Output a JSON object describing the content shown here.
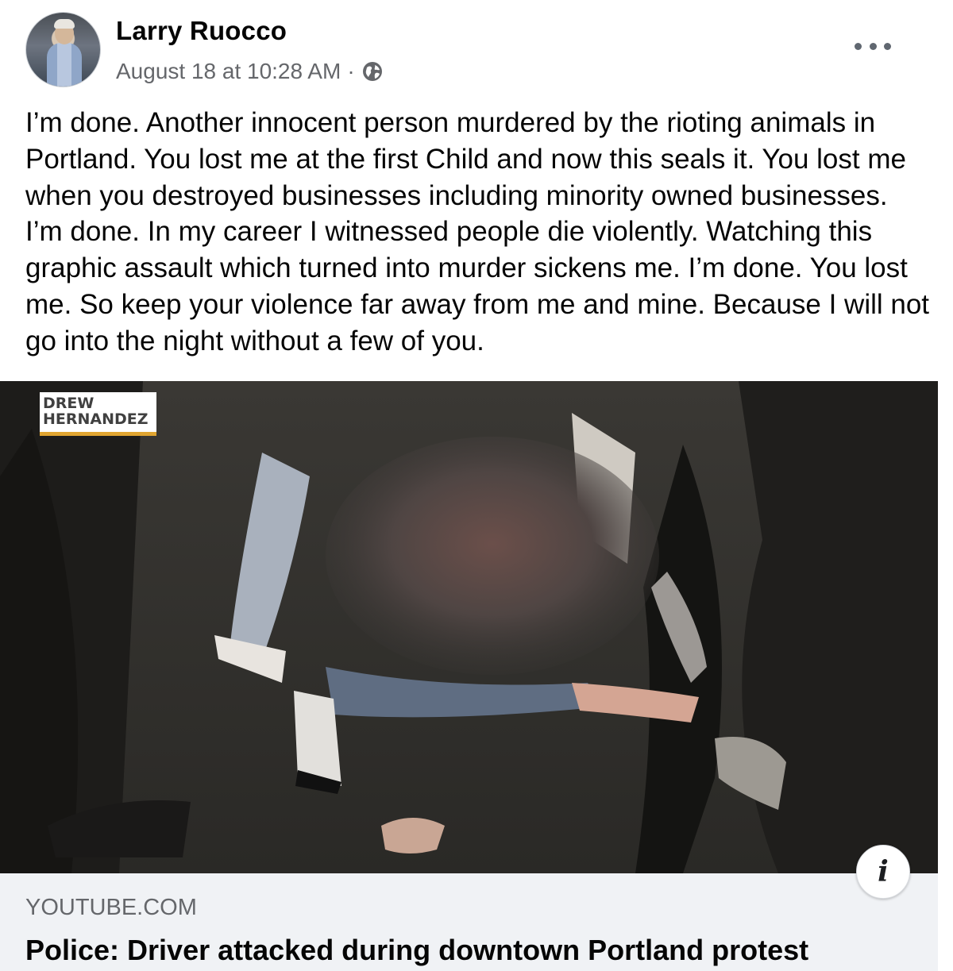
{
  "post": {
    "author": "Larry Ruocco",
    "timestamp": "August 18 at 10:28 AM",
    "separator": "·",
    "privacy_icon": "globe-icon",
    "more_icon": "more-options-icon",
    "text": "I’m done. Another innocent person murdered by the rioting animals in Portland. You lost me at the first Child and now this seals it. You lost me when you destroyed businesses including minority owned businesses. I’m done. In my career I witnessed people die violently. Watching this graphic assault which turned into murder sickens me. I’m done. You lost me. So keep your violence far away from me and mine. Because I will not go into the night without a few of you."
  },
  "media": {
    "watermark_line1": "DREW",
    "watermark_line2": "HERNANDEZ",
    "info_icon": "info-icon",
    "info_label": "i"
  },
  "link": {
    "domain": "YOUTUBE.COM",
    "title": "Police: Driver attacked during downtown Portland protest"
  },
  "colors": {
    "name_text": "#050505",
    "meta_text": "#65676b",
    "card_background": "#f0f2f5",
    "watermark_accent": "#e0a531"
  }
}
